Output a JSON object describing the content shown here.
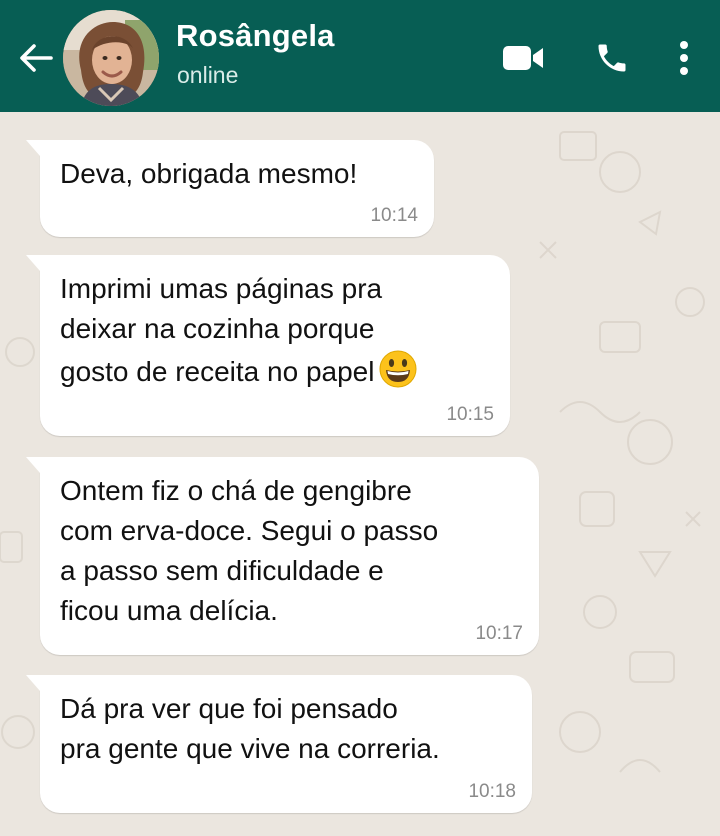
{
  "header": {
    "back_icon": "arrow-left-icon",
    "contact_name": "Rosângela",
    "status": "online",
    "video_icon": "video-camera-icon",
    "call_icon": "phone-icon",
    "menu_icon": "more-vertical-icon",
    "background_color": "#075e54"
  },
  "messages": [
    {
      "text": "Deva, obrigada mesmo!",
      "time": "10:14"
    },
    {
      "text": "Imprimi umas páginas pra\ndeixar na cozinha porque\ngosto de receita no papel",
      "emoji": "grinning-face-emoji",
      "time": "10:15"
    },
    {
      "text": "Ontem fiz o chá de gengibre\ncom erva-doce. Segui o passo\na passo sem dificuldade e\nficou uma delícia.",
      "time": "10:17"
    },
    {
      "text": "Dá pra ver que foi pensado\npra gente que vive na correria.",
      "time": "10:18"
    }
  ],
  "colors": {
    "chat_background": "#ebe6df",
    "bubble": "#ffffff",
    "timestamp": "#8a8a8a"
  }
}
